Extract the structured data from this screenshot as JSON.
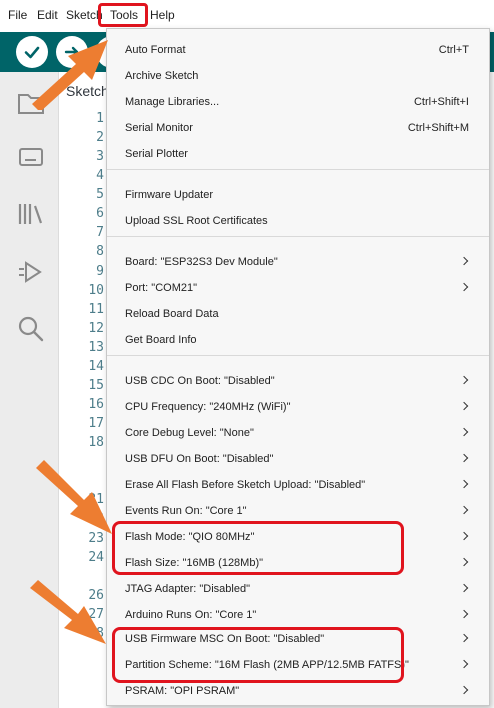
{
  "menubar": {
    "items": [
      "File",
      "Edit",
      "Sketch",
      "Tools",
      "Help"
    ]
  },
  "editor": {
    "tab_label": "Sketch",
    "line_numbers": [
      "1",
      "2",
      "3",
      "4",
      "5",
      "6",
      "7",
      "8",
      "9",
      "10",
      "11",
      "12",
      "13",
      "14",
      "15",
      "16",
      "17",
      "18",
      "",
      "",
      "21",
      "22",
      "23",
      "24",
      "",
      "26",
      "27",
      "28"
    ]
  },
  "tools_menu": {
    "groups": [
      [
        {
          "label": "Auto Format",
          "shortcut": "Ctrl+T"
        },
        {
          "label": "Archive Sketch",
          "shortcut": ""
        },
        {
          "label": "Manage Libraries...",
          "shortcut": "Ctrl+Shift+I"
        },
        {
          "label": "Serial Monitor",
          "shortcut": "Ctrl+Shift+M"
        },
        {
          "label": "Serial Plotter",
          "shortcut": ""
        }
      ],
      [
        {
          "label": "Firmware Updater",
          "shortcut": ""
        },
        {
          "label": "Upload SSL Root Certificates",
          "shortcut": ""
        }
      ],
      [
        {
          "label": "Board: \"ESP32S3 Dev Module\"",
          "submenu": true
        },
        {
          "label": "Port: \"COM21\"",
          "submenu": true
        },
        {
          "label": "Reload Board Data",
          "submenu": false
        },
        {
          "label": "Get Board Info",
          "submenu": false
        }
      ],
      [
        {
          "label": "USB CDC On Boot: \"Disabled\"",
          "submenu": true
        },
        {
          "label": "CPU Frequency: \"240MHz (WiFi)\"",
          "submenu": true
        },
        {
          "label": "Core Debug Level: \"None\"",
          "submenu": true
        },
        {
          "label": "USB DFU On Boot: \"Disabled\"",
          "submenu": true
        },
        {
          "label": "Erase All Flash Before Sketch Upload: \"Disabled\"",
          "submenu": true
        },
        {
          "label": "Events Run On: \"Core 1\"",
          "submenu": true
        },
        {
          "label": "Flash Mode: \"QIO 80MHz\"",
          "submenu": true
        },
        {
          "label": "Flash Size: \"16MB (128Mb)\"",
          "submenu": true
        },
        {
          "label": "JTAG Adapter: \"Disabled\"",
          "submenu": true
        },
        {
          "label": "Arduino Runs On: \"Core 1\"",
          "submenu": true
        },
        {
          "label": "USB Firmware MSC On Boot: \"Disabled\"",
          "submenu": true
        },
        {
          "label": "Partition Scheme: \"16M Flash (2MB APP/12.5MB FATFS)\"",
          "submenu": true
        },
        {
          "label": "PSRAM: \"OPI PSRAM\"",
          "submenu": true
        }
      ]
    ]
  },
  "colors": {
    "toolbar": "#006468",
    "highlight": "#e0141e",
    "arrow": "#ed7d31"
  }
}
